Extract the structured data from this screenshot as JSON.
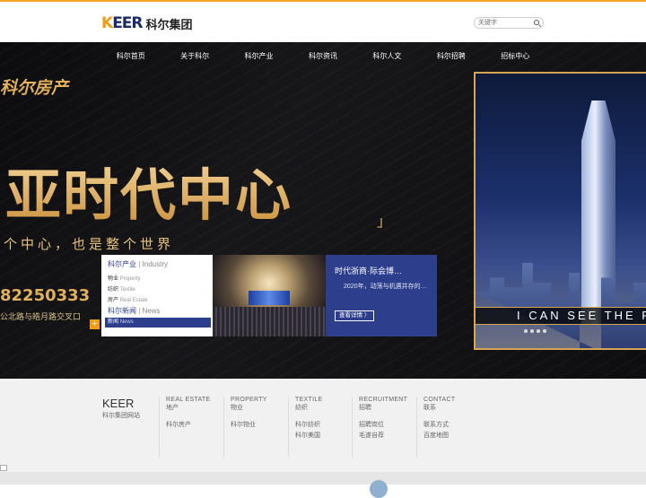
{
  "header": {
    "logo_mark_k": "K",
    "logo_mark_rest": "EER",
    "logo_cn": "科尔集团",
    "search_placeholder": "关键字"
  },
  "nav": [
    "科尔首页",
    "关于科尔",
    "科尔产业",
    "科尔资讯",
    "科尔人文",
    "科尔招聘",
    "招标中心"
  ],
  "banner": {
    "brand_text": "科尔房产",
    "slogan": "亚时代中心",
    "bracket": "」",
    "subslogan": "个中心，也是整个世界",
    "phone": "82250333",
    "address": "公北路与皓月路交叉口",
    "frame_caption": "I CAN SEE THE FUTURE"
  },
  "menu_panel": {
    "industry": {
      "cn": "科尔产业",
      "sep": "|",
      "en": "Industry"
    },
    "items": [
      {
        "cn": "物业",
        "en": "Property"
      },
      {
        "cn": "纺织",
        "en": "Textile"
      },
      {
        "cn": "房产",
        "en": "Real Estate"
      }
    ],
    "news": {
      "cn": "科尔新闻",
      "sep": "|",
      "en": "News"
    },
    "news_row": {
      "cn": "新闻",
      "en": "News"
    },
    "plus": "+"
  },
  "news_card": {
    "title": "时代浙商·际会博…",
    "text": "2020年，动荡与机遇并存的…",
    "button": "查看详情 〉"
  },
  "footer": {
    "brand_en": "KEER",
    "brand_cn": "科尔集团网站",
    "columns": [
      {
        "en": "REAL ESTATE",
        "cn": "地产",
        "links": [
          "科尔房产"
        ]
      },
      {
        "en": "PROPERTY",
        "cn": "物业",
        "links": [
          "科尔物业"
        ]
      },
      {
        "en": "TEXTILE",
        "cn": "纺织",
        "links": [
          "科尔纺织",
          "科尔美国"
        ]
      },
      {
        "en": "RECRUITMENT",
        "cn": "招聘",
        "links": [
          "招聘岗位",
          "毛遂自荐"
        ]
      },
      {
        "en": "CONTACT",
        "cn": "联系",
        "links": [
          "联系方式",
          "百度地图"
        ]
      }
    ]
  },
  "colors": {
    "accent": "#f39c12",
    "brand_blue": "#2c3e8c",
    "gold": "#e0b05a"
  }
}
